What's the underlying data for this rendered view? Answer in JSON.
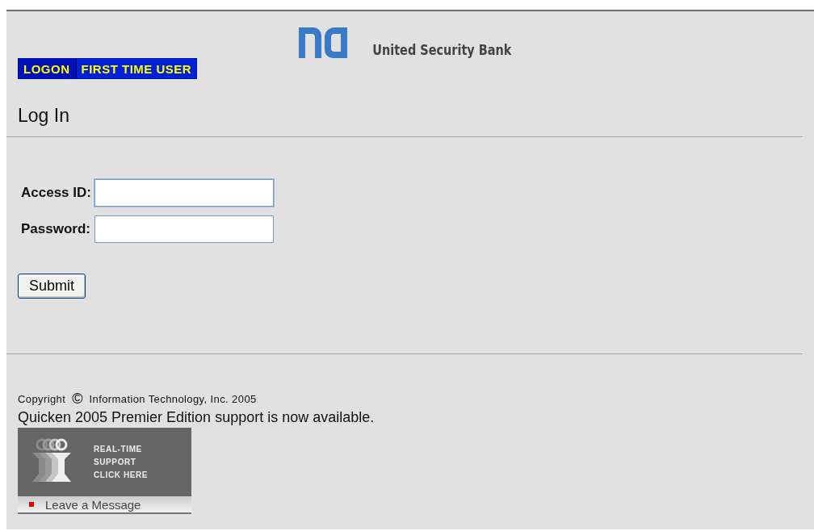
{
  "bank_name": "United Security Bank",
  "tabs": [
    {
      "label": "LOGON",
      "selected": true
    },
    {
      "label": "FIRST TIME USER",
      "selected": false
    }
  ],
  "heading": "Log In",
  "fields": [
    {
      "label": "Access ID:",
      "focused": true
    },
    {
      "label": "Password:",
      "focused": false
    }
  ],
  "submit": "Submit",
  "copyright": {
    "prefix": "Copyright",
    "symbol": "©",
    "owner": "Information Technology, Inc. 2005"
  },
  "notice": "Quicken 2005 Premier Edition support is now available.",
  "support_banner": {
    "lines": [
      "REAL-TIME",
      "SUPPORT",
      "CLICK HERE"
    ],
    "message": "Leave a Message"
  }
}
